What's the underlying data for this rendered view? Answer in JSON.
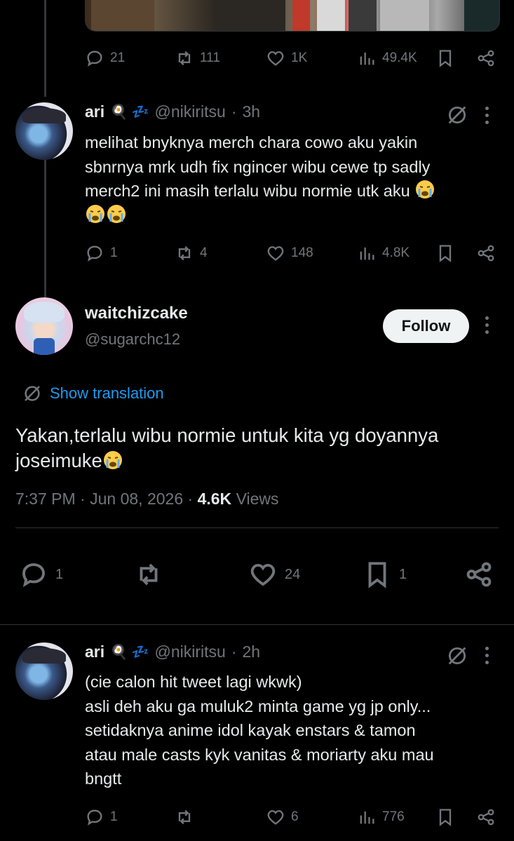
{
  "prev_tweet": {
    "stats": {
      "replies": "21",
      "reposts": "111",
      "likes": "1K",
      "views": "49.4K"
    }
  },
  "reply1": {
    "name": "ari",
    "emojis": "🍳 💤",
    "handle": "@nikiritsu",
    "time": "3h",
    "text_lines": [
      "melihat bnyknya merch chara cowo aku yakin",
      "sbnrnya mrk udh fix ngincer wibu cewe tp sadly",
      "merch2 ini masih terlalu wibu normie utk aku"
    ],
    "stats": {
      "replies": "1",
      "reposts": "4",
      "likes": "148",
      "views": "4.8K"
    }
  },
  "main_tweet": {
    "name": "waitchizcake",
    "handle": "@sugarchc12",
    "follow_label": "Follow",
    "translate_label": "Show translation",
    "text_lines": [
      "Yakan,terlalu wibu normie untuk kita yg doyannya",
      "joseimuke"
    ],
    "time": "7:37 PM",
    "date": "Jun 08, 2026",
    "views_count": "4.6K",
    "views_label": "Views",
    "stats": {
      "replies": "1",
      "reposts": "",
      "likes": "24",
      "bookmarks": "1"
    }
  },
  "reply2": {
    "name": "ari",
    "emojis": "🍳 💤",
    "handle": "@nikiritsu",
    "time": "2h",
    "text_lines": [
      "(cie calon hit tweet lagi wkwk)",
      "asli deh aku ga muluk2 minta game yg jp only...",
      "setidaknya anime idol kayak enstars & tamon",
      "atau male casts kyk vanitas & moriarty aku mau",
      "bngtt"
    ],
    "stats": {
      "replies": "1",
      "reposts": "",
      "likes": "6",
      "views": "776"
    }
  },
  "colors": {
    "background": "#000000",
    "text": "#e7e9ea",
    "muted": "#71767b",
    "link": "#1d9bf0",
    "divider": "#2f3336"
  }
}
